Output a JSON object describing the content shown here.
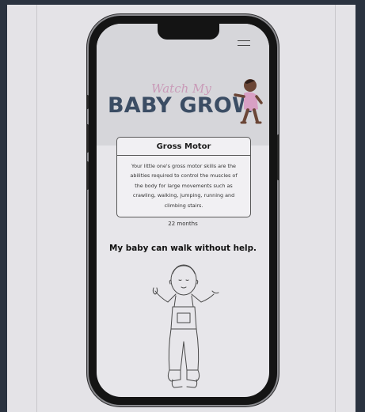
{
  "hero": {
    "logo_script": "Watch My",
    "logo_main": "BABY GROW"
  },
  "card": {
    "title": "Gross Motor",
    "body": "Your little one's gross motor skills are the abilities required to control the muscles of the body for large movements such as crawling, walking, jumping, running and climbing stairs."
  },
  "age_label": "22 months",
  "milestone": "My baby can walk without help.",
  "icons": {
    "menu": "hamburger-menu-icon"
  },
  "colors": {
    "logo_main": "#3b4d64",
    "logo_script": "#c99bb8",
    "hero_bg": "#d6d6da"
  }
}
